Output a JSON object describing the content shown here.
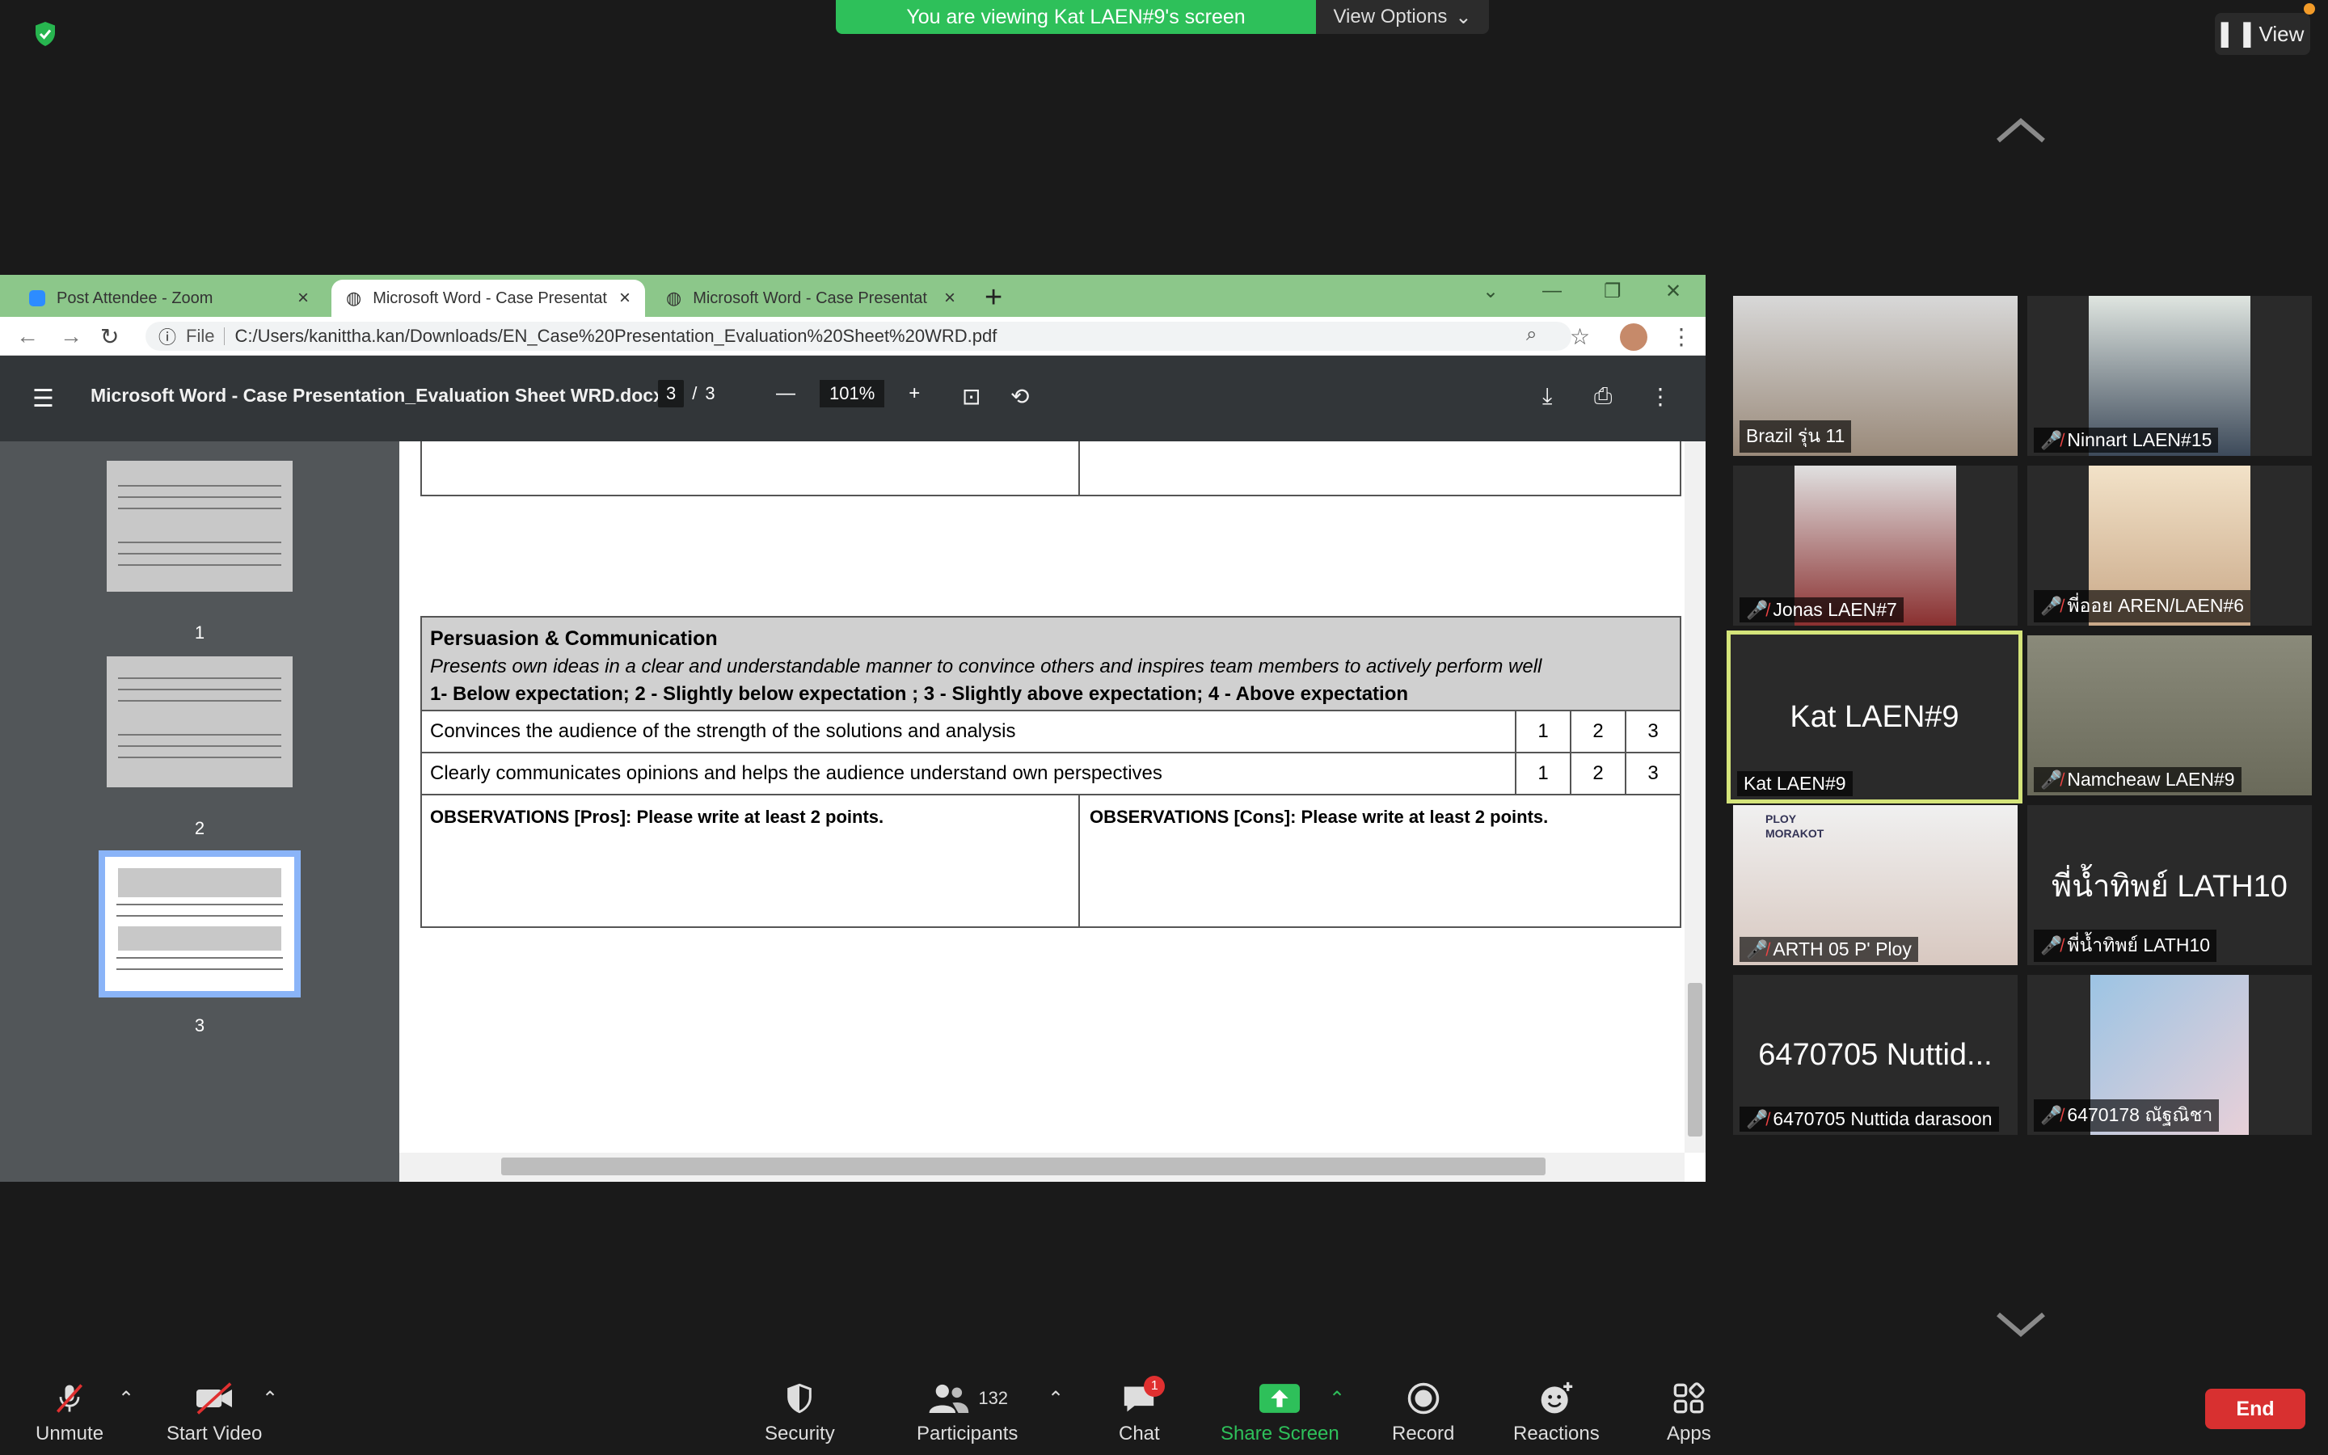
{
  "zoom": {
    "banner_text": "You are viewing Kat LAEN#9's screen",
    "view_options_label": "View Options",
    "view_label": "View"
  },
  "browser": {
    "tabs": [
      {
        "label": "Post Attendee - Zoom"
      },
      {
        "label": "Microsoft Word - Case Presentat"
      },
      {
        "label": "Microsoft Word - Case Presentat"
      }
    ],
    "address_prefix": "File",
    "address": "C:/Users/kanittha.kan/Downloads/EN_Case%20Presentation_Evaluation%20Sheet%20WRD.pdf"
  },
  "pdf": {
    "title": "Microsoft Word - Case Presentation_Evaluation Sheet WRD.docx",
    "page_current": "3",
    "page_sep": "/",
    "page_total": "3",
    "zoom_level": "101%",
    "thumbnails": [
      "1",
      "2",
      "3"
    ]
  },
  "document": {
    "section_title": "Persuasion & Communication",
    "section_desc": "Presents own ideas in a clear and understandable manner to convince others and inspires team members to actively perform well",
    "scale": "1- Below expectation;  2 - Slightly below expectation ; 3 - Slightly above expectation;  4 - Above expectation",
    "criteria": [
      {
        "text": "Convinces the audience of the strength of the solutions and analysis",
        "scores": [
          "1",
          "2",
          "3"
        ]
      },
      {
        "text": "Clearly communicates opinions and helps the audience understand own perspectives",
        "scores": [
          "1",
          "2",
          "3"
        ]
      }
    ],
    "obs_pros": "OBSERVATIONS [Pros]: Please write at least 2 points.",
    "obs_cons": "OBSERVATIONS [Cons]: Please write at least 2 points."
  },
  "participants": [
    {
      "name": "Brazil รุ่น 11",
      "muted": false
    },
    {
      "name": "Ninnart LAEN#15",
      "muted": true
    },
    {
      "name": "Jonas LAEN#7",
      "muted": true
    },
    {
      "name": "พี่ออย AREN/LAEN#6",
      "muted": true
    },
    {
      "name": "Kat LAEN#9",
      "muted": false,
      "big": "Kat LAEN#9"
    },
    {
      "name": "Namcheaw LAEN#9",
      "muted": true
    },
    {
      "name": "ARTH 05 P' Ploy",
      "muted": true,
      "overlay": "PLOY MORAKOT"
    },
    {
      "name": "พี่น้ำทิพย์ LATH10",
      "muted": true,
      "big": "พี่น้ำทิพย์ LATH10"
    },
    {
      "name": "6470705 Nuttida darasoon",
      "muted": true,
      "big": "6470705 Nuttid..."
    },
    {
      "name": "6470178 ณัฐณิชา",
      "muted": true
    }
  ],
  "toolbar": {
    "unmute": "Unmute",
    "start_video": "Start Video",
    "security": "Security",
    "participants": "Participants",
    "participants_count": "132",
    "chat": "Chat",
    "chat_badge": "1",
    "share_screen": "Share Screen",
    "record": "Record",
    "reactions": "Reactions",
    "apps": "Apps",
    "end": "End"
  },
  "colors": {
    "banner_green": "#2ec05a",
    "end_red": "#d83030",
    "speaker_border": "#d4e47a",
    "muted_red": "#e44444"
  }
}
